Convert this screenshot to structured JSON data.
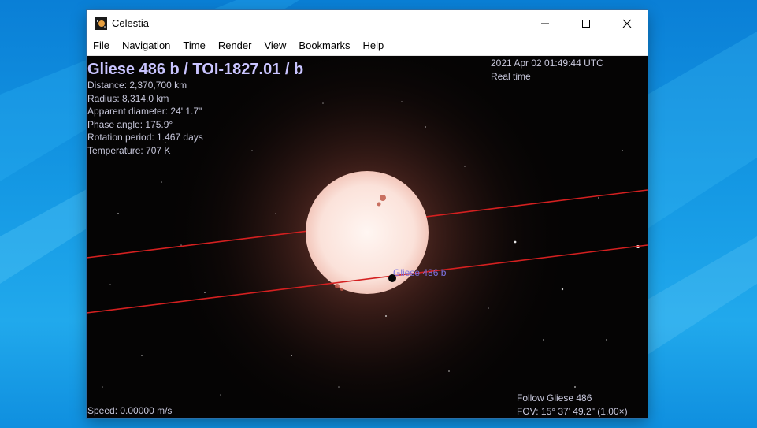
{
  "window": {
    "title": "Celestia",
    "controls": {
      "minimize": "minimize-icon",
      "maximize": "maximize-icon",
      "close": "close-icon"
    }
  },
  "menu": [
    "File",
    "Navigation",
    "Time",
    "Render",
    "View",
    "Bookmarks",
    "Help"
  ],
  "hud": {
    "object_name": "Gliese 486 b / TOI-1827.01 / b",
    "distance": "Distance: 2,370,700 km",
    "radius": "Radius: 8,314.0 km",
    "apparent_diameter": "Apparent diameter: 24' 1.7\"",
    "phase_angle": "Phase angle: 175.9°",
    "rotation_period": "Rotation period: 1.467 days",
    "temperature": "Temperature: 707 K",
    "datetime": "2021 Apr 02 01:49:44 UTC",
    "time_mode": "Real time",
    "follow": "Follow Gliese 486",
    "fov": "FOV: 15° 37' 49.2\" (1.00×)",
    "speed": "Speed: 0.00000 m/s"
  },
  "scene": {
    "planet_label": "Gliese 486 b"
  },
  "colors": {
    "hud_text": "#c8c8dc",
    "hud_title": "#c9c4ff",
    "orbit_line": "#d42020",
    "planet_label": "#7b72e0",
    "star_core": "#fff0ea"
  }
}
